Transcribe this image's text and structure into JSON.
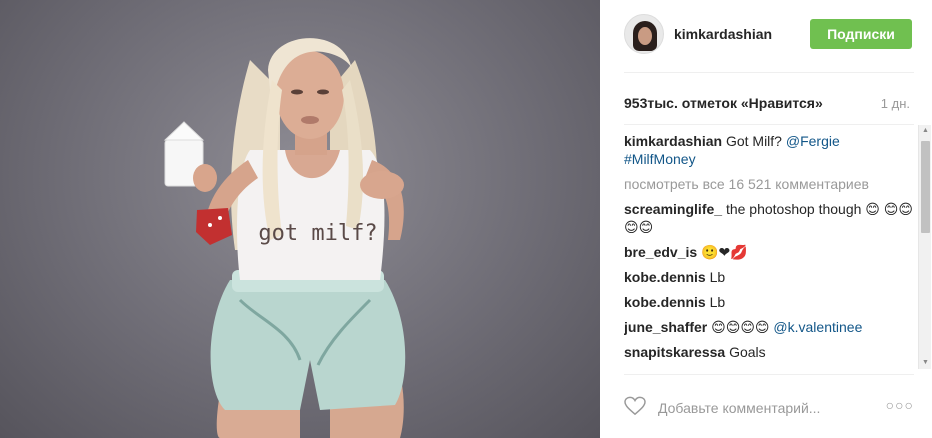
{
  "header": {
    "username": "kimkardashian",
    "follow_label": "Подписки"
  },
  "stats": {
    "likes": "953тыс. отметок «Нравится»",
    "age": "1 дн."
  },
  "caption": {
    "user": "kimkardashian",
    "text": "Got Milf?",
    "mention": "@Fergie",
    "hashtag": "#MilfMoney"
  },
  "view_all": "посмотреть все 16 521 комментариев",
  "comments": [
    {
      "user": "screaminglife_",
      "text": "the photoshop though 😊 😊😊😊😊",
      "link": ""
    },
    {
      "user": "bre_edv_is",
      "text": "🙂❤💋",
      "link": ""
    },
    {
      "user": "kobe.dennis",
      "text": "Lb",
      "link": ""
    },
    {
      "user": "kobe.dennis",
      "text": "Lb",
      "link": ""
    },
    {
      "user": "june_shaffer",
      "text": "😊😊😊😊",
      "link": "@k.valentinee"
    },
    {
      "user": "snapitskaressa",
      "text": "Goals",
      "link": ""
    }
  ],
  "footer": {
    "comment_placeholder": "Добавьте комментарий...",
    "more_label": "○○○",
    "like_icon": "heart-icon"
  },
  "photo": {
    "shirt_text": "got milf?"
  },
  "colors": {
    "follow_green": "#70c050",
    "link_blue": "#125688",
    "muted": "#999999"
  }
}
